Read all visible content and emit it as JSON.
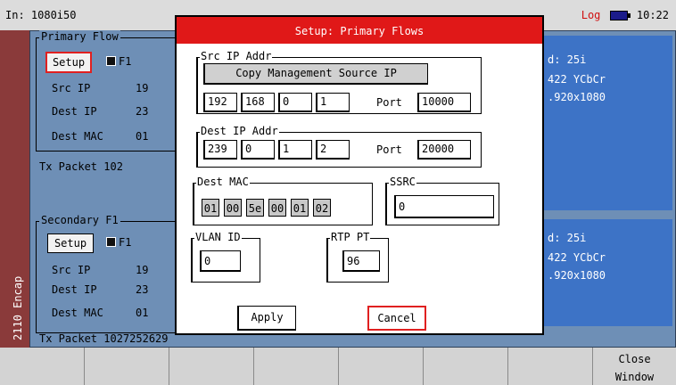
{
  "status": {
    "input": "In: 1080i50",
    "log": "Log",
    "time": "10:22"
  },
  "sidetab": {
    "label": "2110 Encap"
  },
  "primary": {
    "group_title": "Primary Flow",
    "setup_label": "Setup",
    "checkbox_label": "F1",
    "src_ip_label": "Src IP",
    "src_ip_value": "19",
    "dest_ip_label": "Dest IP",
    "dest_ip_value": "23",
    "dest_mac_label": "Dest MAC",
    "dest_mac_value": "01",
    "tx_packet": "Tx Packet 102"
  },
  "secondary": {
    "group_title": "Secondary F1",
    "setup_label": "Setup",
    "checkbox_label": "F1",
    "src_ip_label": "Src IP",
    "src_ip_value": "19",
    "dest_ip_label": "Dest IP",
    "dest_ip_value": "23",
    "dest_mac_label": "Dest MAC",
    "dest_mac_value": "01",
    "tx_packet": "Tx Packet 1027252629"
  },
  "right_top": {
    "line1": "d: 25i",
    "line2": "422 YCbCr",
    "line3": ".920x1080"
  },
  "right_bottom": {
    "line1": "d: 25i",
    "line2": "422 YCbCr",
    "line3": ".920x1080"
  },
  "dialog": {
    "title": "Setup: Primary Flows",
    "src_group": "Src IP Addr",
    "copy_button": "Copy Management Source IP",
    "src_ip": [
      "192",
      "168",
      "0",
      "1"
    ],
    "src_port_label": "Port",
    "src_port": "10000",
    "dest_group": "Dest IP Addr",
    "dest_ip": [
      "239",
      "0",
      "1",
      "2"
    ],
    "dest_port_label": "Port",
    "dest_port": "20000",
    "mac_group": "Dest MAC",
    "mac": [
      "01",
      "00",
      "5e",
      "00",
      "01",
      "02"
    ],
    "ssrc_group": "SSRC",
    "ssrc": "0",
    "vlan_group": "VLAN ID",
    "vlan": "0",
    "rtp_group": "RTP PT",
    "rtp": "96",
    "apply": "Apply",
    "cancel": "Cancel"
  },
  "softkeys": {
    "close_line1": "Close",
    "close_line2": "Window"
  },
  "colors": {
    "titlebar": "#e01818",
    "panel": "#6e8fb6",
    "info": "#3d73c6",
    "sidetab": "#8a3a3a",
    "selection": "#e02020"
  }
}
